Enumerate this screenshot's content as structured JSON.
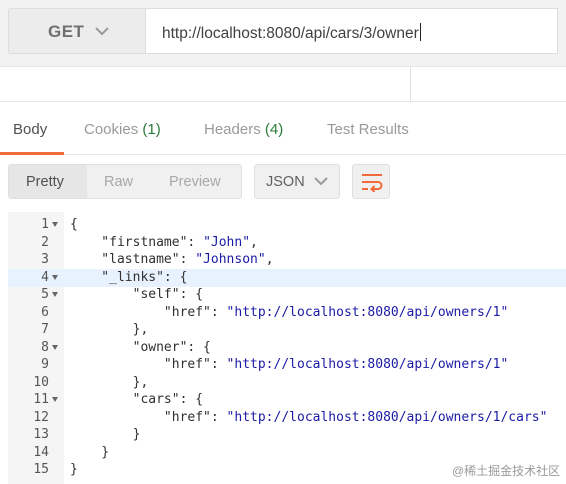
{
  "request": {
    "method": "GET",
    "url": "http://localhost:8080/api/cars/3/owner"
  },
  "tabs": [
    {
      "label": "Body",
      "count": ""
    },
    {
      "label": "Cookies",
      "count": "(1)"
    },
    {
      "label": "Headers",
      "count": "(4)"
    },
    {
      "label": "Test Results",
      "count": ""
    }
  ],
  "toolbar": {
    "formats": [
      "Pretty",
      "Raw",
      "Preview"
    ],
    "language": "JSON"
  },
  "code_lines": [
    {
      "n": "1",
      "fold": true,
      "tokens": [
        {
          "t": "{",
          "c": "p"
        }
      ]
    },
    {
      "n": "2",
      "fold": false,
      "tokens": [
        {
          "t": "    \"firstname\": ",
          "c": "k"
        },
        {
          "t": "\"John\"",
          "c": "s"
        },
        {
          "t": ",",
          "c": "p"
        }
      ]
    },
    {
      "n": "3",
      "fold": false,
      "tokens": [
        {
          "t": "    \"lastname\": ",
          "c": "k"
        },
        {
          "t": "\"Johnson\"",
          "c": "s"
        },
        {
          "t": ",",
          "c": "p"
        }
      ]
    },
    {
      "n": "4",
      "fold": true,
      "tokens": [
        {
          "t": "    \"_links\":",
          "c": "k"
        },
        {
          "t": " {",
          "c": "p"
        }
      ]
    },
    {
      "n": "5",
      "fold": true,
      "tokens": [
        {
          "t": "        \"self\": {",
          "c": "k"
        }
      ]
    },
    {
      "n": "6",
      "fold": false,
      "tokens": [
        {
          "t": "            \"href\": ",
          "c": "k"
        },
        {
          "t": "\"http://localhost:8080/api/owners/1\"",
          "c": "s"
        }
      ]
    },
    {
      "n": "7",
      "fold": false,
      "tokens": [
        {
          "t": "        },",
          "c": "p"
        }
      ]
    },
    {
      "n": "8",
      "fold": true,
      "tokens": [
        {
          "t": "        \"owner\": {",
          "c": "k"
        }
      ]
    },
    {
      "n": "9",
      "fold": false,
      "tokens": [
        {
          "t": "            \"href\": ",
          "c": "k"
        },
        {
          "t": "\"http://localhost:8080/api/owners/1\"",
          "c": "s"
        }
      ]
    },
    {
      "n": "10",
      "fold": false,
      "tokens": [
        {
          "t": "        },",
          "c": "p"
        }
      ]
    },
    {
      "n": "11",
      "fold": true,
      "tokens": [
        {
          "t": "        \"cars\": {",
          "c": "k"
        }
      ]
    },
    {
      "n": "12",
      "fold": false,
      "tokens": [
        {
          "t": "            \"href\": ",
          "c": "k"
        },
        {
          "t": "\"http://localhost:8080/api/owners/1/cars\"",
          "c": "s"
        }
      ]
    },
    {
      "n": "13",
      "fold": false,
      "tokens": [
        {
          "t": "        }",
          "c": "p"
        }
      ]
    },
    {
      "n": "14",
      "fold": false,
      "tokens": [
        {
          "t": "    }",
          "c": "p"
        }
      ]
    },
    {
      "n": "15",
      "fold": false,
      "tokens": [
        {
          "t": "}",
          "c": "p"
        }
      ]
    }
  ],
  "highlighted_line": "4",
  "watermark": "@稀土掘金技术社区",
  "colors": {
    "accent": "#f26b3a",
    "count": "#2a7a3a",
    "string": "#1a1aa6",
    "highlight": "#e8f2fe"
  }
}
